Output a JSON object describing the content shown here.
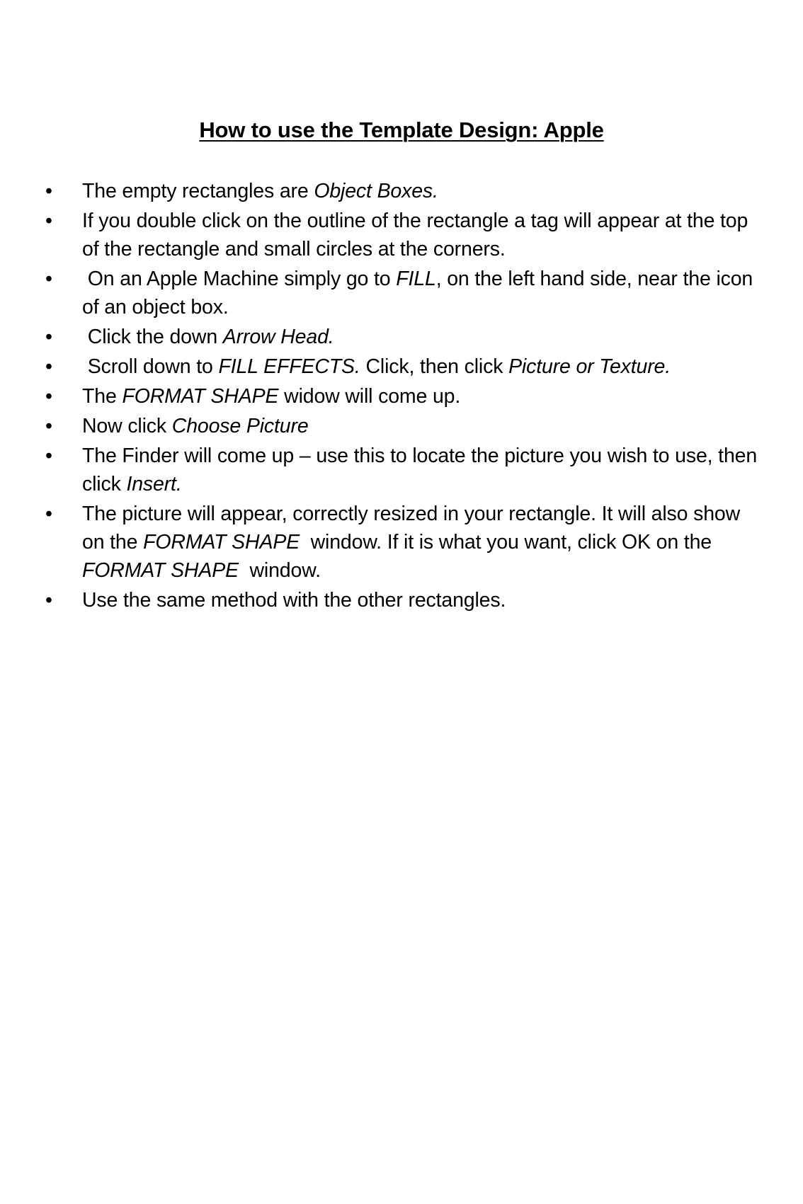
{
  "document": {
    "title": "How to use the Template Design: Apple",
    "bullet_marker": "•",
    "bullets": [
      {
        "id": "object-boxes",
        "segments": [
          {
            "text": "The empty rectangles are ",
            "style": "normal"
          },
          {
            "text": "Object Boxes.",
            "style": "italic"
          }
        ]
      },
      {
        "id": "double-click-outline",
        "segments": [
          {
            "text": "If you double click on the outline of the rectangle a tag will appear at the top of the rectangle and small circles at the corners.",
            "style": "normal"
          }
        ]
      },
      {
        "id": "apple-machine-fill",
        "segments": [
          {
            "text": " On an Apple Machine simply go to ",
            "style": "normal"
          },
          {
            "text": "FILL",
            "style": "italic"
          },
          {
            "text": ", on the left hand side, near the icon of an object box.",
            "style": "normal"
          }
        ]
      },
      {
        "id": "click-arrow-head",
        "segments": [
          {
            "text": " Click the down ",
            "style": "normal"
          },
          {
            "text": "Arrow Head.",
            "style": "italic"
          }
        ]
      },
      {
        "id": "scroll-fill-effects",
        "segments": [
          {
            "text": " Scroll down to ",
            "style": "normal"
          },
          {
            "text": "FILL EFFECTS.",
            "style": "italic"
          },
          {
            "text": " Click, then click ",
            "style": "normal"
          },
          {
            "text": "Picture or Texture.",
            "style": "italic"
          }
        ]
      },
      {
        "id": "format-shape-window",
        "segments": [
          {
            "text": "The ",
            "style": "normal"
          },
          {
            "text": "FORMAT SHAPE",
            "style": "italic"
          },
          {
            "text": " widow will come up.",
            "style": "normal"
          }
        ]
      },
      {
        "id": "now-click-choose-picture",
        "segments": [
          {
            "text": "Now click ",
            "style": "normal"
          },
          {
            "text": "Choose Picture",
            "style": "italic"
          }
        ]
      },
      {
        "id": "finder-insert",
        "segments": [
          {
            "text": "The Finder will come up – use this to locate the picture you wish to use, then click ",
            "style": "normal"
          },
          {
            "text": "Insert.",
            "style": "italic"
          }
        ]
      },
      {
        "id": "picture-resized-ok",
        "segments": [
          {
            "text": "The picture will appear, correctly resized in your rectangle. It will also show on the ",
            "style": "normal"
          },
          {
            "text": "FORMAT SHAPE",
            "style": "italic"
          },
          {
            "text": "  window. If it is what you want, click OK on the ",
            "style": "normal"
          },
          {
            "text": "FORMAT SHAPE",
            "style": "italic"
          },
          {
            "text": "  window.",
            "style": "normal"
          }
        ]
      },
      {
        "id": "same-method-others",
        "segments": [
          {
            "text": "Use the same method with the other rectangles.",
            "style": "normal"
          }
        ]
      }
    ]
  },
  "colors": {
    "page_background": "#ffffff",
    "text": "#000000"
  }
}
